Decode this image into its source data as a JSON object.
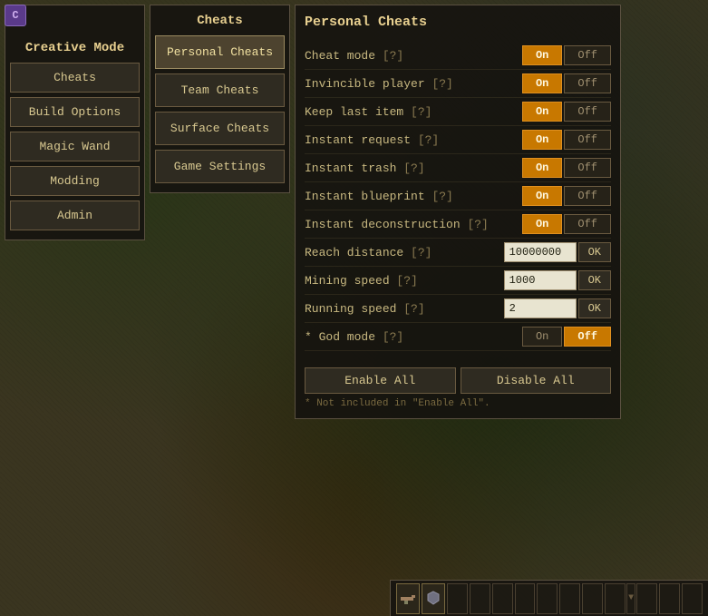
{
  "app": {
    "icon": "C",
    "title": "Creative Mode"
  },
  "nav": {
    "title": "Creative Mode",
    "buttons": [
      {
        "label": "Cheats",
        "id": "cheats"
      },
      {
        "label": "Build Options",
        "id": "build-options"
      },
      {
        "label": "Magic Wand",
        "id": "magic-wand"
      },
      {
        "label": "Modding",
        "id": "modding"
      },
      {
        "label": "Admin",
        "id": "admin"
      }
    ]
  },
  "middle": {
    "title": "Cheats",
    "buttons": [
      {
        "label": "Personal Cheats",
        "id": "personal-cheats",
        "active": true
      },
      {
        "label": "Team Cheats",
        "id": "team-cheats"
      },
      {
        "label": "Surface Cheats",
        "id": "surface-cheats"
      },
      {
        "label": "Game Settings",
        "id": "game-settings"
      }
    ]
  },
  "personal_cheats": {
    "title": "Personal Cheats",
    "settings": [
      {
        "id": "cheat-mode",
        "label": "Cheat mode",
        "help": "[?]",
        "type": "toggle",
        "state": "on"
      },
      {
        "id": "invincible-player",
        "label": "Invincible player",
        "help": "[?]",
        "type": "toggle",
        "state": "on"
      },
      {
        "id": "keep-last-item",
        "label": "Keep last item",
        "help": "[?]",
        "type": "toggle",
        "state": "on"
      },
      {
        "id": "instant-request",
        "label": "Instant request",
        "help": "[?]",
        "type": "toggle",
        "state": "on"
      },
      {
        "id": "instant-trash",
        "label": "Instant trash",
        "help": "[?]",
        "type": "toggle",
        "state": "on"
      },
      {
        "id": "instant-blueprint",
        "label": "Instant blueprint",
        "help": "[?]",
        "type": "toggle",
        "state": "on"
      },
      {
        "id": "instant-deconstruction",
        "label": "Instant deconstruction",
        "help": "[?]",
        "type": "toggle",
        "state": "on"
      },
      {
        "id": "reach-distance",
        "label": "Reach distance",
        "help": "[?]",
        "type": "input",
        "value": "10000000"
      },
      {
        "id": "mining-speed",
        "label": "Mining speed",
        "help": "[?]",
        "type": "input",
        "value": "1000"
      },
      {
        "id": "running-speed",
        "label": "Running speed",
        "help": "[?]",
        "type": "input",
        "value": "2"
      },
      {
        "id": "god-mode",
        "label": "* God mode",
        "help": "[?]",
        "type": "toggle",
        "state": "off"
      }
    ],
    "actions": {
      "enable_all": "Enable All",
      "disable_all": "Disable All"
    },
    "note": "* Not included in \"Enable All\".",
    "on_label": "On",
    "off_label": "Off",
    "ok_label": "OK"
  },
  "toolbar": {
    "slots": [
      {
        "has_item": true,
        "type": "gun"
      },
      {
        "has_item": true,
        "type": "armor"
      },
      {
        "has_item": false
      },
      {
        "has_item": false
      },
      {
        "has_item": false
      },
      {
        "has_item": false
      },
      {
        "has_item": false
      },
      {
        "has_item": false
      },
      {
        "has_item": false
      },
      {
        "has_item": false
      },
      {
        "has_item": false
      }
    ],
    "scroll_icon": "▼"
  }
}
